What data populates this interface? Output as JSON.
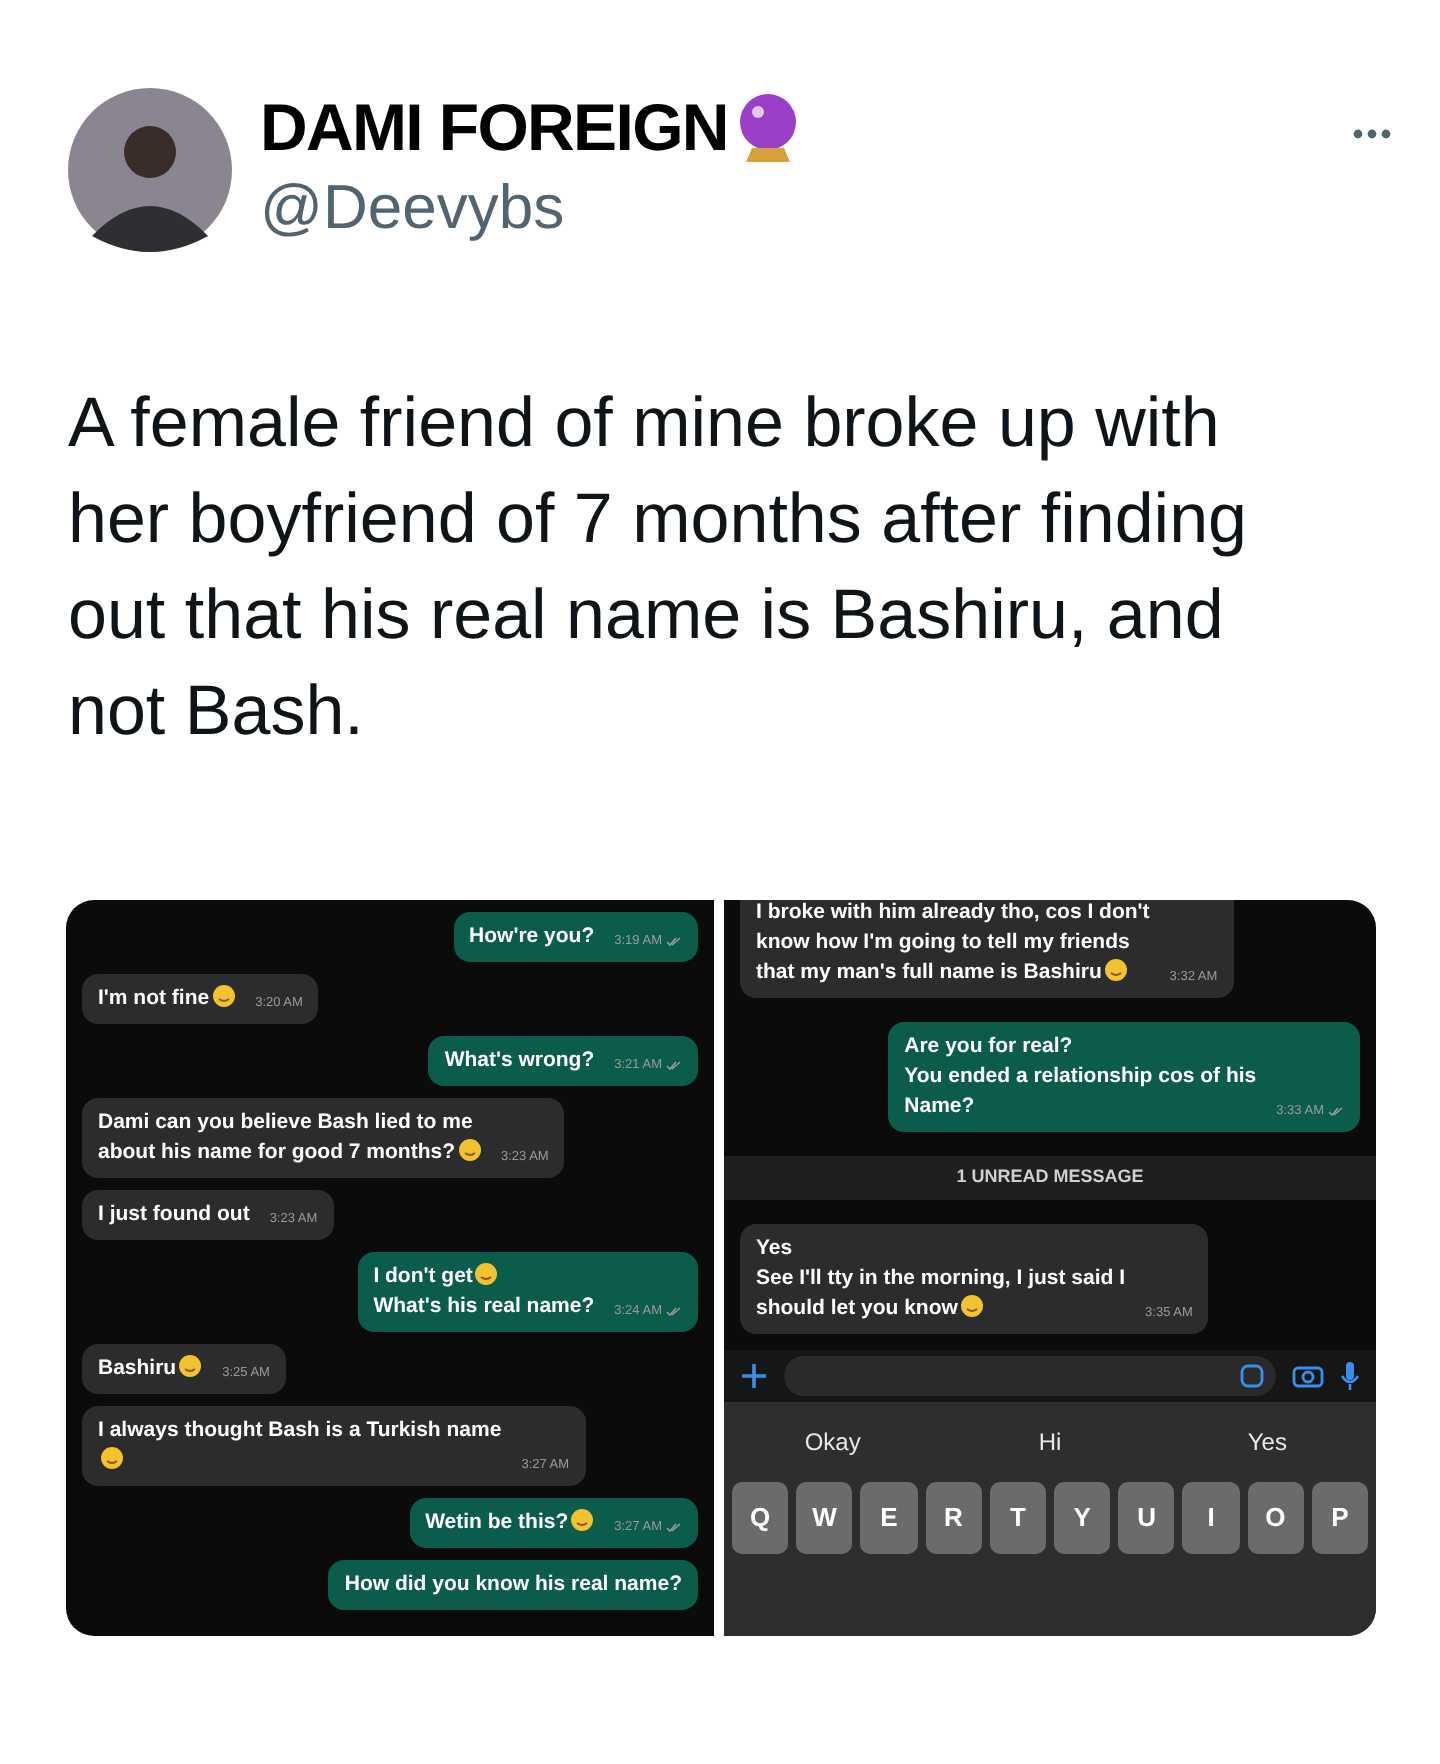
{
  "tweet": {
    "author": {
      "name": "DAMI FOREIGN",
      "handle": "@Deevybs"
    },
    "text": "A female friend of mine broke up with her boyfriend of 7 months after finding out that his real name is Bashiru, and not Bash."
  },
  "chat_left": {
    "messages": [
      {
        "kind": "outgoing",
        "lines": [
          {
            "text": "How're you?",
            "emoji": false
          }
        ],
        "time": "3:19 AM"
      },
      {
        "kind": "incoming",
        "lines": [
          {
            "text": "I'm not fine",
            "emoji": true
          }
        ],
        "time": "3:20 AM"
      },
      {
        "kind": "outgoing",
        "lines": [
          {
            "text": "What's wrong?",
            "emoji": false
          }
        ],
        "time": "3:21 AM"
      },
      {
        "kind": "incoming",
        "lines": [
          {
            "text": "Dami can you believe Bash lied to me",
            "emoji": false
          },
          {
            "text": "about his name for good 7 months?",
            "emoji": true
          }
        ],
        "time": "3:23 AM"
      },
      {
        "kind": "incoming",
        "lines": [
          {
            "text": "I just found out",
            "emoji": false
          }
        ],
        "time": "3:23 AM"
      },
      {
        "kind": "outgoing",
        "lines": [
          {
            "text": "I don't get",
            "emoji": true
          },
          {
            "text": "What's his real name?",
            "emoji": false
          }
        ],
        "time": "3:24 AM"
      },
      {
        "kind": "incoming",
        "lines": [
          {
            "text": "Bashiru",
            "emoji": true
          }
        ],
        "time": "3:25 AM"
      },
      {
        "kind": "incoming",
        "lines": [
          {
            "text": "I always thought Bash is a Turkish name",
            "emoji": false
          },
          {
            "emoji": true
          }
        ],
        "time": "3:27 AM"
      },
      {
        "kind": "outgoing",
        "lines": [
          {
            "text": "Wetin be this?",
            "emoji": true
          }
        ],
        "time": "3:27 AM"
      },
      {
        "kind": "outgoing",
        "lines": [
          {
            "text": "How did you know his real name?",
            "emoji": false
          }
        ]
      }
    ]
  },
  "chat_right": {
    "messages": [
      {
        "kind": "incoming",
        "lines": [
          {
            "text": "I broke with him already tho, cos I don't",
            "emoji": false
          },
          {
            "text": "know how I'm going to tell my friends",
            "emoji": false
          },
          {
            "text": "that my man's full name is Bashiru",
            "emoji": true
          }
        ],
        "time": "3:32 AM"
      },
      {
        "kind": "outgoing",
        "lines": [
          {
            "text": "Are you for real?",
            "emoji": false
          },
          {
            "text": "You ended a relationship cos of his",
            "emoji": false
          },
          {
            "text": "Name?",
            "emoji": false
          }
        ],
        "time": "3:33 AM"
      },
      {
        "kind": "divider",
        "text": "1 UNREAD MESSAGE"
      },
      {
        "kind": "incoming",
        "lines": [
          {
            "text": "Yes",
            "emoji": false
          },
          {
            "text": "See I'll tty in the morning, I just said I",
            "emoji": false
          },
          {
            "text": "should let you know",
            "emoji": true
          }
        ],
        "time": "3:35 AM"
      }
    ],
    "suggestions": [
      "Okay",
      "Hi",
      "Yes"
    ],
    "keys": [
      "Q",
      "W",
      "E",
      "R",
      "T",
      "Y",
      "U",
      "I",
      "O",
      "P"
    ]
  }
}
